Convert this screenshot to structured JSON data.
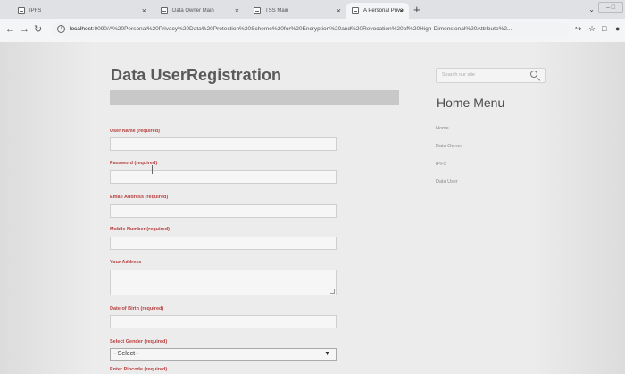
{
  "browser": {
    "tabs": [
      {
        "title": "IPFS",
        "active": false
      },
      {
        "title": "Data Owner Main",
        "active": false
      },
      {
        "title": "TSS Main",
        "active": false
      },
      {
        "title": "A Personal Privacy Data Protecti",
        "active": true
      }
    ],
    "new_tab": "+",
    "window_controls": "– □",
    "url_host": "localhost",
    "url_rest": ":9090/A%20Personal%20Privacy%20Data%20Protection%20Scheme%20for%20Encryption%20and%20Revocation%20of%20High-Dimensional%20Attribute%2..."
  },
  "page": {
    "title": "Data UserRegistration",
    "form": {
      "username_label": "User Name (required)",
      "password_label": "Password (required)",
      "email_label": "Email Address (required)",
      "mobile_label": "Mobile Number (required)",
      "address_label": "Your Address",
      "dob_label": "Date of Birth (required)",
      "gender_label": "Select Gender (required)",
      "gender_selected": "--Select--",
      "pincode_label": "Enter Pincode (required)"
    }
  },
  "sidebar": {
    "search_placeholder": "Search our site",
    "menu_title": "Home  Menu",
    "items": [
      "Home",
      "Data Owner",
      "IPFS",
      "Data User"
    ]
  },
  "icons": {
    "tab_close": "×",
    "back": "←",
    "forward": "→",
    "reload": "↻",
    "share": "↪",
    "star": "☆",
    "sidepanel": "□",
    "profile": "●",
    "chevron_down": "⌄",
    "select_arrow": "▼"
  }
}
